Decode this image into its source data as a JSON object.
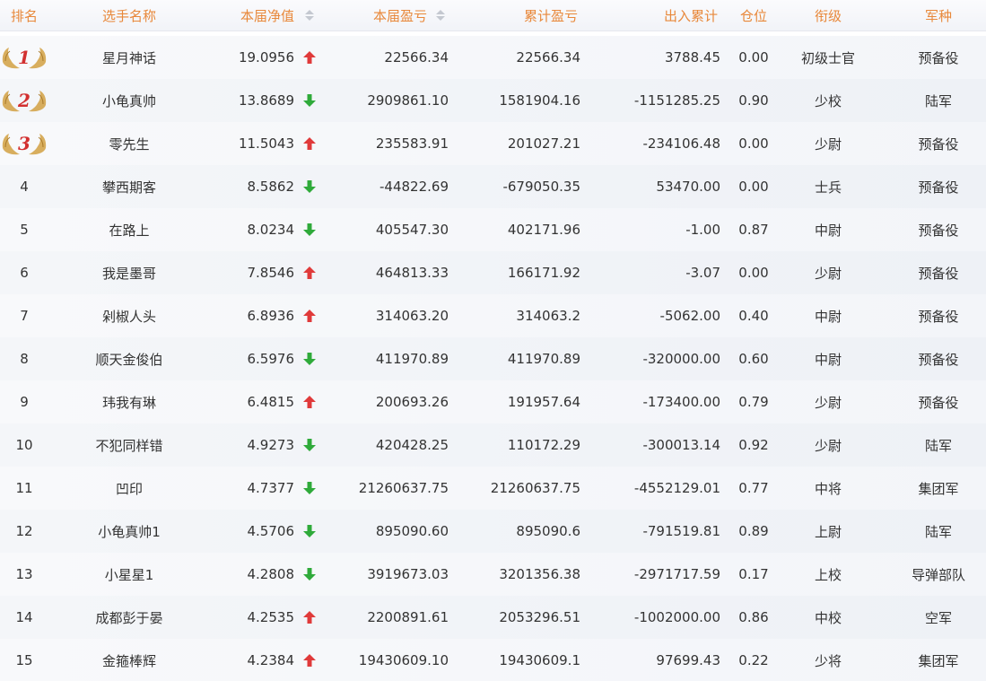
{
  "header": {
    "rank": "排名",
    "name": "选手名称",
    "nav": "本届净值",
    "profit": "本届盈亏",
    "total": "累计盈亏",
    "flow": "出入累计",
    "position": "仓位",
    "title": "衔级",
    "army": "军种"
  },
  "colors": {
    "header_text": "#e8883a",
    "up": "#e03a3a",
    "down": "#2faa3a",
    "medal": "#d4a54d"
  },
  "rows": [
    {
      "rank": "1",
      "medal": true,
      "trend": "up",
      "name": "星月神话",
      "nav": "19.0956",
      "profit": "22566.34",
      "total": "22566.34",
      "flow": "3788.45",
      "position": "0.00",
      "title": "初级士官",
      "army": "预备役"
    },
    {
      "rank": "2",
      "medal": true,
      "trend": "down",
      "name": "小龟真帅",
      "nav": "13.8689",
      "profit": "2909861.10",
      "total": "1581904.16",
      "flow": "-1151285.25",
      "position": "0.90",
      "title": "少校",
      "army": "陆军"
    },
    {
      "rank": "3",
      "medal": true,
      "trend": "up",
      "name": "零先生",
      "nav": "11.5043",
      "profit": "235583.91",
      "total": "201027.21",
      "flow": "-234106.48",
      "position": "0.00",
      "title": "少尉",
      "army": "预备役"
    },
    {
      "rank": "4",
      "medal": false,
      "trend": "down",
      "name": "攀西期客",
      "nav": "8.5862",
      "profit": "-44822.69",
      "total": "-679050.35",
      "flow": "53470.00",
      "position": "0.00",
      "title": "士兵",
      "army": "预备役"
    },
    {
      "rank": "5",
      "medal": false,
      "trend": "down",
      "name": "在路上",
      "nav": "8.0234",
      "profit": "405547.30",
      "total": "402171.96",
      "flow": "-1.00",
      "position": "0.87",
      "title": "中尉",
      "army": "预备役"
    },
    {
      "rank": "6",
      "medal": false,
      "trend": "up",
      "name": "我是墨哥",
      "nav": "7.8546",
      "profit": "464813.33",
      "total": "166171.92",
      "flow": "-3.07",
      "position": "0.00",
      "title": "少尉",
      "army": "预备役"
    },
    {
      "rank": "7",
      "medal": false,
      "trend": "up",
      "name": "剁椒人头",
      "nav": "6.8936",
      "profit": "314063.20",
      "total": "314063.2",
      "flow": "-5062.00",
      "position": "0.40",
      "title": "中尉",
      "army": "预备役"
    },
    {
      "rank": "8",
      "medal": false,
      "trend": "down",
      "name": "顺天金俊伯",
      "nav": "6.5976",
      "profit": "411970.89",
      "total": "411970.89",
      "flow": "-320000.00",
      "position": "0.60",
      "title": "中尉",
      "army": "预备役"
    },
    {
      "rank": "9",
      "medal": false,
      "trend": "up",
      "name": "玮我有琳",
      "nav": "6.4815",
      "profit": "200693.26",
      "total": "191957.64",
      "flow": "-173400.00",
      "position": "0.79",
      "title": "少尉",
      "army": "预备役"
    },
    {
      "rank": "10",
      "medal": false,
      "trend": "down",
      "name": "不犯同样错",
      "nav": "4.9273",
      "profit": "420428.25",
      "total": "110172.29",
      "flow": "-300013.14",
      "position": "0.92",
      "title": "少尉",
      "army": "陆军"
    },
    {
      "rank": "11",
      "medal": false,
      "trend": "down",
      "name": "凹印",
      "nav": "4.7377",
      "profit": "21260637.75",
      "total": "21260637.75",
      "flow": "-4552129.01",
      "position": "0.77",
      "title": "中将",
      "army": "集团军"
    },
    {
      "rank": "12",
      "medal": false,
      "trend": "down",
      "name": "小龟真帅1",
      "nav": "4.5706",
      "profit": "895090.60",
      "total": "895090.6",
      "flow": "-791519.81",
      "position": "0.89",
      "title": "上尉",
      "army": "陆军"
    },
    {
      "rank": "13",
      "medal": false,
      "trend": "down",
      "name": "小星星1",
      "nav": "4.2808",
      "profit": "3919673.03",
      "total": "3201356.38",
      "flow": "-2971717.59",
      "position": "0.17",
      "title": "上校",
      "army": "导弹部队"
    },
    {
      "rank": "14",
      "medal": false,
      "trend": "up",
      "name": "成都彭于晏",
      "nav": "4.2535",
      "profit": "2200891.61",
      "total": "2053296.51",
      "flow": "-1002000.00",
      "position": "0.86",
      "title": "中校",
      "army": "空军"
    },
    {
      "rank": "15",
      "medal": false,
      "trend": "up",
      "name": "金箍棒辉",
      "nav": "4.2384",
      "profit": "19430609.10",
      "total": "19430609.1",
      "flow": "97699.43",
      "position": "0.22",
      "title": "少将",
      "army": "集团军"
    }
  ]
}
